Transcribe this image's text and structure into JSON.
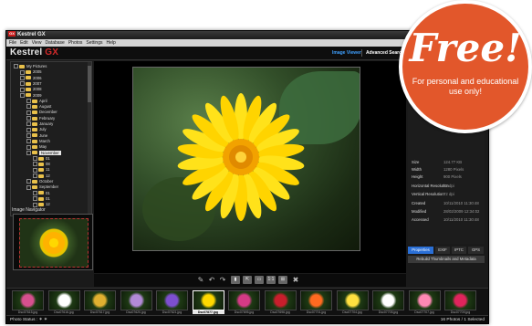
{
  "app": {
    "title": "Kestrel GX",
    "icon_label": "GX",
    "brand_main": "Kestrel",
    "brand_accent": "GX"
  },
  "menu": [
    "File",
    "Edit",
    "View",
    "Database",
    "Photos",
    "Settings",
    "Help"
  ],
  "header": {
    "image_viewer": "Image Viewer",
    "advanced_search": "Advanced Search"
  },
  "tree": {
    "items": [
      {
        "label": "My Pictures"
      },
      {
        "label": "2005"
      },
      {
        "label": "2006"
      },
      {
        "label": "2007"
      },
      {
        "label": "2008"
      },
      {
        "label": "2009"
      },
      {
        "label": "April"
      },
      {
        "label": "August"
      },
      {
        "label": "December"
      },
      {
        "label": "February"
      },
      {
        "label": "January"
      },
      {
        "label": "July"
      },
      {
        "label": "June"
      },
      {
        "label": "March"
      },
      {
        "label": "May"
      },
      {
        "label": "November"
      },
      {
        "label": "01"
      },
      {
        "label": "08"
      },
      {
        "label": "11"
      },
      {
        "label": "12"
      },
      {
        "label": "October"
      },
      {
        "label": "September"
      },
      {
        "label": "01"
      },
      {
        "label": "01"
      },
      {
        "label": "12"
      }
    ]
  },
  "navigator": {
    "label": "Image Navigator"
  },
  "info": {
    "rows": [
      {
        "label": "Size",
        "value": "124.77 KB"
      },
      {
        "label": "Width",
        "value": "1280 Pixels"
      },
      {
        "label": "Height",
        "value": "900 Pixels"
      },
      {
        "label": "Horizontal Resolution",
        "value": "72 dpi"
      },
      {
        "label": "Vertical Resolution",
        "value": "72 dpi"
      },
      {
        "label": "Created",
        "value": "10/11/2010 11:30:48"
      },
      {
        "label": "Modified",
        "value": "28/02/2009 12:34:02"
      },
      {
        "label": "Accessed",
        "value": "10/11/2010 11:30:48"
      }
    ]
  },
  "tabs": [
    "Properties",
    "EXIF",
    "IPTC",
    "GPS"
  ],
  "rebuild_label": "Rebuild Thumbnails and Metadata",
  "toolbar": {
    "actual_size": "1:1"
  },
  "thumbnails": [
    {
      "caption": "Dsc07615.jpg",
      "color": "#d6508e"
    },
    {
      "caption": "Dsc07616.jpg",
      "color": "#ffffff"
    },
    {
      "caption": "Dsc07617.jpg",
      "color": "#e0b030"
    },
    {
      "caption": "Dsc07620.jpg",
      "color": "#b28ad6"
    },
    {
      "caption": "Dsc07621.jpg",
      "color": "#7d4fd0"
    },
    {
      "caption": "Dsc07877.jpg",
      "color": "#ffd800"
    },
    {
      "caption": "Dsc07695.jpg",
      "color": "#d53a86"
    },
    {
      "caption": "Dsc07696.jpg",
      "color": "#c81e2c"
    },
    {
      "caption": "Dsc07701.jpg",
      "color": "#ff6a20"
    },
    {
      "caption": "Dsc07704.jpg",
      "color": "#ffe040"
    },
    {
      "caption": "Dsc07705.jpg",
      "color": "#ffffff"
    },
    {
      "caption": "Dsc07707.jpg",
      "color": "#ff88b4"
    },
    {
      "caption": "Dsc07709.jpg",
      "color": "#e0245c"
    }
  ],
  "selected_thumb": 5,
  "status": {
    "left": "Photo Status :",
    "right": "16 Photos / 1 Selected"
  },
  "badge": {
    "title": "Free!",
    "subtitle": "For personal and educational use only!"
  }
}
